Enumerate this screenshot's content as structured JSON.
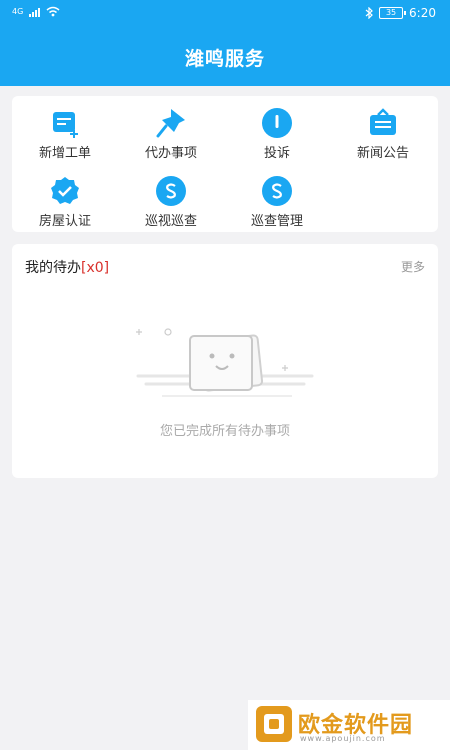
{
  "status_bar": {
    "network": "4G",
    "time": "6:20",
    "battery": "35"
  },
  "header": {
    "title": "潍鸣服务"
  },
  "menu": {
    "items": [
      {
        "label": "新增工单",
        "icon": "new-ticket-icon"
      },
      {
        "label": "代办事项",
        "icon": "pin-icon"
      },
      {
        "label": "投诉",
        "icon": "complaint-icon"
      },
      {
        "label": "新闻公告",
        "icon": "announcement-icon"
      },
      {
        "label": "房屋认证",
        "icon": "verified-badge-icon"
      },
      {
        "label": "巡视巡查",
        "icon": "patrol-icon"
      },
      {
        "label": "巡查管理",
        "icon": "patrol-management-icon"
      }
    ]
  },
  "todo": {
    "title": "我的待办",
    "count": "[x0]",
    "more": "更多",
    "empty_text": "您已完成所有待办事项"
  },
  "watermark": {
    "text": "欧金软件园",
    "url": "www.apoujin.com"
  },
  "colors": {
    "primary": "#1aa7f2",
    "accent_red": "#d9302b",
    "watermark_orange": "#e39a1d"
  }
}
